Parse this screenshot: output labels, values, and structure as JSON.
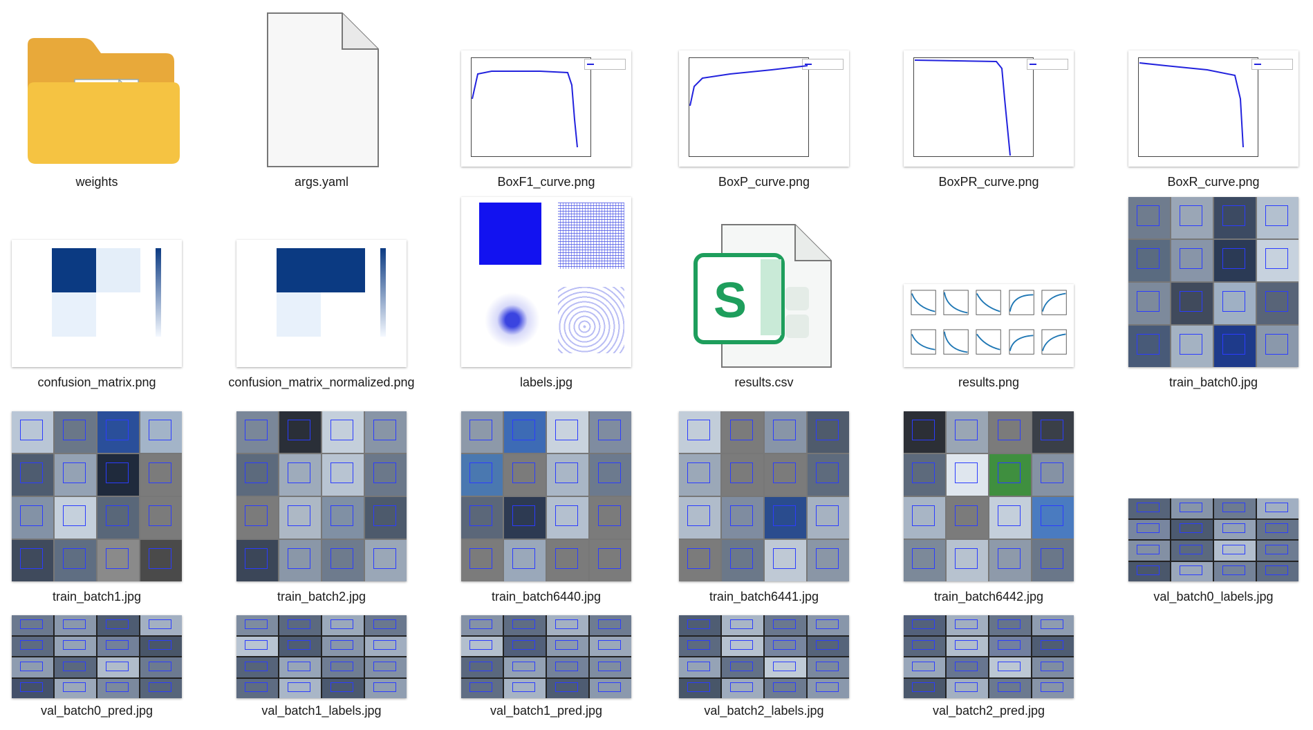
{
  "files": [
    {
      "name": "weights",
      "icon": "folder-icon"
    },
    {
      "name": "args.yaml",
      "icon": "document-icon"
    },
    {
      "name": "BoxF1_curve.png",
      "icon": "image-thumbnail"
    },
    {
      "name": "BoxP_curve.png",
      "icon": "image-thumbnail"
    },
    {
      "name": "BoxPR_curve.png",
      "icon": "image-thumbnail"
    },
    {
      "name": "BoxR_curve.png",
      "icon": "image-thumbnail"
    },
    {
      "name": "confusion_matrix.png",
      "icon": "image-thumbnail"
    },
    {
      "name": "confusion_matrix_normalized.png",
      "icon": "image-thumbnail"
    },
    {
      "name": "labels.jpg",
      "icon": "image-thumbnail"
    },
    {
      "name": "results.csv",
      "icon": "spreadsheet-icon"
    },
    {
      "name": "results.png",
      "icon": "image-thumbnail"
    },
    {
      "name": "train_batch0.jpg",
      "icon": "image-thumbnail"
    },
    {
      "name": "train_batch1.jpg",
      "icon": "image-thumbnail"
    },
    {
      "name": "train_batch2.jpg",
      "icon": "image-thumbnail"
    },
    {
      "name": "train_batch6440.jpg",
      "icon": "image-thumbnail"
    },
    {
      "name": "train_batch6441.jpg",
      "icon": "image-thumbnail"
    },
    {
      "name": "train_batch6442.jpg",
      "icon": "image-thumbnail"
    },
    {
      "name": "val_batch0_labels.jpg",
      "icon": "image-thumbnail"
    },
    {
      "name": "val_batch0_pred.jpg",
      "icon": "image-thumbnail"
    },
    {
      "name": "val_batch1_labels.jpg",
      "icon": "image-thumbnail"
    },
    {
      "name": "val_batch1_pred.jpg",
      "icon": "image-thumbnail"
    },
    {
      "name": "val_batch2_labels.jpg",
      "icon": "image-thumbnail"
    },
    {
      "name": "val_batch2_pred.jpg",
      "icon": "image-thumbnail"
    }
  ],
  "colors": {
    "folder": "#f5c342",
    "folder_back": "#e8a93a",
    "spreadsheet_green": "#1e9e5c",
    "curve_blue": "#2222dd"
  }
}
